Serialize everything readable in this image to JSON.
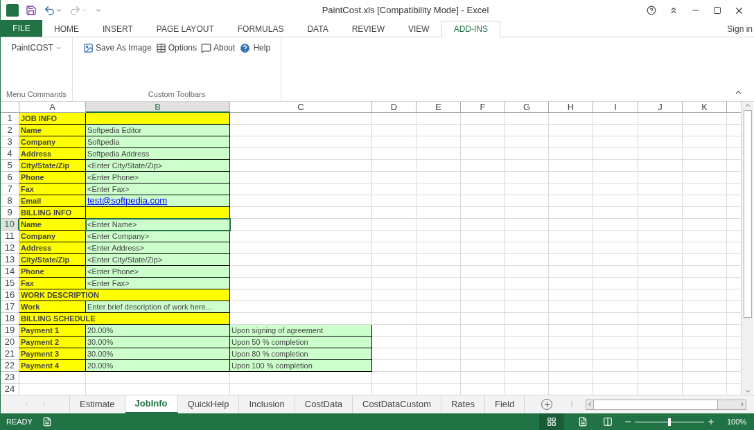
{
  "window": {
    "title": "PaintCost.xls  [Compatibility Mode] - Excel",
    "sign_in": "Sign in"
  },
  "ribbon_tabs": [
    {
      "label": "FILE",
      "kind": "file",
      "selected": false
    },
    {
      "label": "HOME",
      "kind": "tab",
      "selected": false
    },
    {
      "label": "INSERT",
      "kind": "tab",
      "selected": false
    },
    {
      "label": "PAGE LAYOUT",
      "kind": "tab",
      "selected": false
    },
    {
      "label": "FORMULAS",
      "kind": "tab",
      "selected": false
    },
    {
      "label": "DATA",
      "kind": "tab",
      "selected": false
    },
    {
      "label": "REVIEW",
      "kind": "tab",
      "selected": false
    },
    {
      "label": "VIEW",
      "kind": "tab",
      "selected": false
    },
    {
      "label": "ADD-INS",
      "kind": "tab",
      "selected": true
    }
  ],
  "ribbon_groups": [
    {
      "label": "Menu Commands",
      "items": [
        {
          "label": "PaintCOST",
          "kind": "dropdown"
        }
      ]
    },
    {
      "label": "Custom Toolbars",
      "items": [
        {
          "label": "Save As Image",
          "kind": "image"
        },
        {
          "label": "Options",
          "kind": "table"
        },
        {
          "label": "About",
          "kind": "speech"
        },
        {
          "label": "Help",
          "kind": "help"
        }
      ]
    }
  ],
  "columns": [
    {
      "label": "A",
      "selected": false
    },
    {
      "label": "B",
      "selected": true
    },
    {
      "label": "C",
      "selected": false
    },
    {
      "label": "D",
      "selected": false
    },
    {
      "label": "E",
      "selected": false
    },
    {
      "label": "F",
      "selected": false
    },
    {
      "label": "G",
      "selected": false
    },
    {
      "label": "H",
      "selected": false
    },
    {
      "label": "I",
      "selected": false
    },
    {
      "label": "J",
      "selected": false
    },
    {
      "label": "K",
      "selected": false
    }
  ],
  "rows": [
    {
      "number": "1",
      "selected": false,
      "cells": [
        {
          "kind": "label",
          "text": "JOB INFO"
        },
        {
          "kind": "fill"
        }
      ]
    },
    {
      "number": "2",
      "selected": false,
      "cells": [
        {
          "kind": "label",
          "text": "Name"
        },
        {
          "kind": "value",
          "text": "Softpedia Editor"
        }
      ]
    },
    {
      "number": "3",
      "selected": false,
      "cells": [
        {
          "kind": "label",
          "text": "Company"
        },
        {
          "kind": "value",
          "text": "Softpedia"
        }
      ]
    },
    {
      "number": "4",
      "selected": false,
      "cells": [
        {
          "kind": "label",
          "text": "Address"
        },
        {
          "kind": "value",
          "text": "Softpedia Address"
        }
      ]
    },
    {
      "number": "5",
      "selected": false,
      "cells": [
        {
          "kind": "label",
          "text": "City/State/Zip"
        },
        {
          "kind": "value",
          "text": "<Enter City/State/Zip>"
        }
      ]
    },
    {
      "number": "6",
      "selected": false,
      "cells": [
        {
          "kind": "label",
          "text": "Phone"
        },
        {
          "kind": "value",
          "text": "<Enter Phone>"
        }
      ]
    },
    {
      "number": "7",
      "selected": false,
      "cells": [
        {
          "kind": "label",
          "text": "Fax"
        },
        {
          "kind": "value",
          "text": "<Enter Fax>"
        }
      ]
    },
    {
      "number": "8",
      "selected": false,
      "cells": [
        {
          "kind": "label",
          "text": "Email"
        },
        {
          "kind": "link",
          "text": "test@softpedia.com"
        }
      ]
    },
    {
      "number": "9",
      "selected": false,
      "cells": [
        {
          "kind": "label",
          "text": "BILLING INFO"
        },
        {
          "kind": "fill"
        }
      ]
    },
    {
      "number": "10",
      "selected": true,
      "cells": [
        {
          "kind": "label",
          "text": "Name"
        },
        {
          "kind": "value",
          "text": "<Enter Name>"
        }
      ]
    },
    {
      "number": "11",
      "selected": false,
      "cells": [
        {
          "kind": "label",
          "text": "Company"
        },
        {
          "kind": "value",
          "text": "<Enter Company>"
        }
      ]
    },
    {
      "number": "12",
      "selected": false,
      "cells": [
        {
          "kind": "label",
          "text": "Address"
        },
        {
          "kind": "value",
          "text": "<Enter Address>"
        }
      ]
    },
    {
      "number": "13",
      "selected": false,
      "cells": [
        {
          "kind": "label",
          "text": "City/State/Zip"
        },
        {
          "kind": "value",
          "text": "<Enter City/State/Zip>"
        }
      ]
    },
    {
      "number": "14",
      "selected": false,
      "cells": [
        {
          "kind": "label",
          "text": "Phone"
        },
        {
          "kind": "value",
          "text": "<Enter Phone>"
        }
      ]
    },
    {
      "number": "15",
      "selected": false,
      "cells": [
        {
          "kind": "label",
          "text": "Fax"
        },
        {
          "kind": "value",
          "text": "<Enter Fax>"
        }
      ]
    },
    {
      "number": "16",
      "selected": false,
      "cells": [
        {
          "kind": "heading",
          "text": "WORK DESCRIPTION"
        }
      ]
    },
    {
      "number": "17",
      "selected": false,
      "cells": [
        {
          "kind": "label",
          "text": "Work"
        },
        {
          "kind": "value",
          "text": "Enter brief description of work here..."
        }
      ]
    },
    {
      "number": "18",
      "selected": false,
      "cells": [
        {
          "kind": "heading",
          "text": "BILLING SCHEDULE"
        }
      ]
    },
    {
      "number": "19",
      "selected": false,
      "cells": [
        {
          "kind": "label",
          "text": "Payment 1"
        },
        {
          "kind": "value",
          "text": "20.00%"
        },
        {
          "kind": "value",
          "text": "Upon signing of agreement"
        }
      ]
    },
    {
      "number": "20",
      "selected": false,
      "cells": [
        {
          "kind": "label",
          "text": "Payment 2"
        },
        {
          "kind": "value",
          "text": "30.00%"
        },
        {
          "kind": "value",
          "text": "Upon 50 % completion"
        }
      ]
    },
    {
      "number": "21",
      "selected": false,
      "cells": [
        {
          "kind": "label",
          "text": "Payment 3"
        },
        {
          "kind": "value",
          "text": "30.00%"
        },
        {
          "kind": "value",
          "text": "Upon 80 % completion"
        }
      ]
    },
    {
      "number": "22",
      "selected": false,
      "cells": [
        {
          "kind": "label",
          "text": "Payment 4"
        },
        {
          "kind": "value",
          "text": "20.00%"
        },
        {
          "kind": "value",
          "text": "Upon 100 % completion"
        }
      ]
    },
    {
      "number": "23",
      "selected": false,
      "cells": []
    },
    {
      "number": "24",
      "selected": false,
      "cells": []
    }
  ],
  "sheet_tabs": [
    {
      "label": "Estimate",
      "selected": false
    },
    {
      "label": "JobInfo",
      "selected": true
    },
    {
      "label": "QuickHelp",
      "selected": false
    },
    {
      "label": "Inclusion",
      "selected": false
    },
    {
      "label": "CostData",
      "selected": false
    },
    {
      "label": "CostDataCustom",
      "selected": false
    },
    {
      "label": "Rates",
      "selected": false
    },
    {
      "label": "Field",
      "selected": false
    }
  ],
  "status_bar": {
    "mode": "READY",
    "zoom": {
      "level": 0.5,
      "reading": "100%"
    }
  }
}
